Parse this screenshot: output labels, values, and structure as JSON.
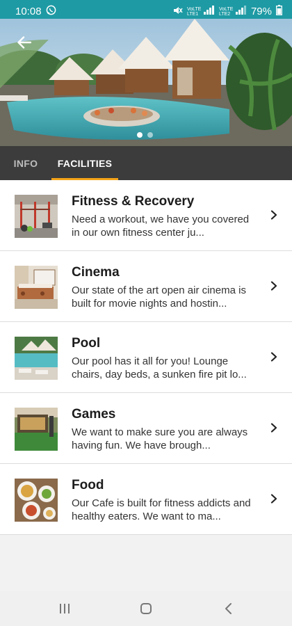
{
  "status_bar": {
    "time": "10:08",
    "left_icon": "whatsapp-icon",
    "right_icons": [
      "mute-icon",
      "volte-lte1-signal-icon",
      "volte-lte2-signal-icon",
      "battery-icon"
    ],
    "lte1_label": "VoLTE LTE1",
    "lte2_label": "VoLTE LTE2",
    "battery": "79%"
  },
  "hero": {
    "image": "resort-villas-pool-photo",
    "back_icon": "arrow-left-icon",
    "carousel_count": 2,
    "carousel_active": 1
  },
  "tabs": [
    {
      "label": "INFO",
      "active": false
    },
    {
      "label": "FACILITIES",
      "active": true
    }
  ],
  "colors": {
    "status_bar": "#1e9aa4",
    "tab_bar": "#3c3c3c",
    "accent": "#f3a318"
  },
  "facilities": [
    {
      "title": "Fitness & Recovery",
      "description": "Need a workout, we have you covered in our own fitness center ju...",
      "thumb": "gym-photo"
    },
    {
      "title": "Cinema",
      "description": "Our state of the art open air cinema is built for movie nights and hostin...",
      "thumb": "cinema-photo"
    },
    {
      "title": "Pool",
      "description": "Our pool has it all for you! Lounge chairs, day beds, a sunken fire pit lo...",
      "thumb": "pool-photo"
    },
    {
      "title": "Games",
      "description": "We want to make sure you are always having fun. We have brough...",
      "thumb": "games-photo"
    },
    {
      "title": "Food",
      "description": "Our Cafe is built for fitness addicts and healthy eaters. We want to ma...",
      "thumb": "food-photo"
    }
  ],
  "navigation_bar": [
    "recent-apps-icon",
    "home-icon",
    "back-icon"
  ]
}
